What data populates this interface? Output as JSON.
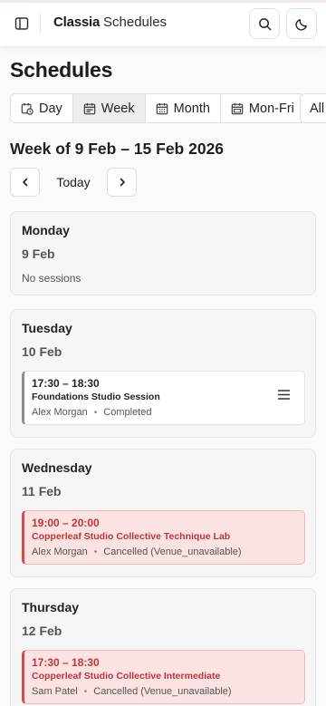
{
  "header": {
    "brand": "Classia",
    "section": "Schedules",
    "icons": [
      "sidebar-toggle-icon",
      "search-icon",
      "moon-icon"
    ]
  },
  "page": {
    "title": "Schedules"
  },
  "view_tabs": [
    {
      "label": "Day",
      "icon": "calendar-clock-icon",
      "active": false
    },
    {
      "label": "Week",
      "icon": "calendar-icon",
      "active": true
    },
    {
      "label": "Month",
      "icon": "calendar-icon",
      "active": false
    },
    {
      "label": "Mon-Fri",
      "icon": "calendar-icon",
      "active": false
    }
  ],
  "all_label": "All",
  "week": {
    "title": "Week of 9 Feb – 15 Feb 2026",
    "today_label": "Today"
  },
  "days": [
    {
      "name": "Monday",
      "date": "9 Feb",
      "empty_text": "No sessions",
      "sessions": []
    },
    {
      "name": "Tuesday",
      "date": "10 Feb",
      "sessions": [
        {
          "time": "17:30 – 18:30",
          "title": "Foundations Studio Session",
          "instructor": "Alex Morgan",
          "status": "Completed"
        }
      ]
    },
    {
      "name": "Wednesday",
      "date": "11 Feb",
      "sessions": [
        {
          "time": "19:00 – 20:00",
          "title": "Copperleaf Studio Collective Technique Lab",
          "instructor": "Alex Morgan",
          "status": "Cancelled (Venue_unavailable)"
        }
      ]
    },
    {
      "name": "Thursday",
      "date": "12 Feb",
      "sessions": [
        {
          "time": "17:30 – 18:30",
          "title": "Copperleaf Studio Collective Intermediate",
          "instructor": "Sam Patel",
          "status": "Cancelled (Venue_unavailable)"
        }
      ]
    }
  ],
  "colors": {
    "cancelled_bg": "#fbe3e3",
    "cancelled_text": "#c23434",
    "completed_border": "#8d8d8d"
  }
}
